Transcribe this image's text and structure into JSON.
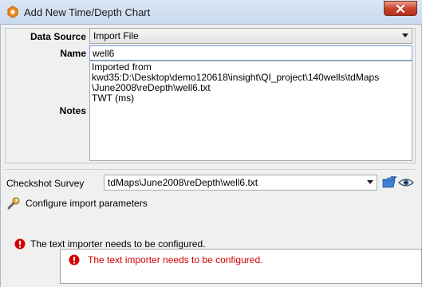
{
  "window": {
    "title": "Add New Time/Depth Chart"
  },
  "form": {
    "data_source_label": "Data Source",
    "data_source_value": "Import File",
    "name_label": "Name",
    "name_value": "well6",
    "notes_label": "Notes",
    "notes_value": "Imported from kwd35:D:\\Desktop\\demo120618\\insight\\QI_project\\140wells\\tdMaps\n\\June2008\\reDepth\\well6.txt\nTWT (ms)"
  },
  "checkshot": {
    "label": "Checkshot Survey",
    "value": "tdMaps\\June2008\\reDepth\\well6.txt"
  },
  "configure": {
    "label": "Configure import parameters"
  },
  "status": {
    "error_text": "The text importer needs to be configured."
  },
  "tooltip": {
    "text": "The text importer needs to be configured."
  },
  "colors": {
    "error": "#d40000",
    "titlebar": "#c9d9ee",
    "close": "#c7432d"
  }
}
